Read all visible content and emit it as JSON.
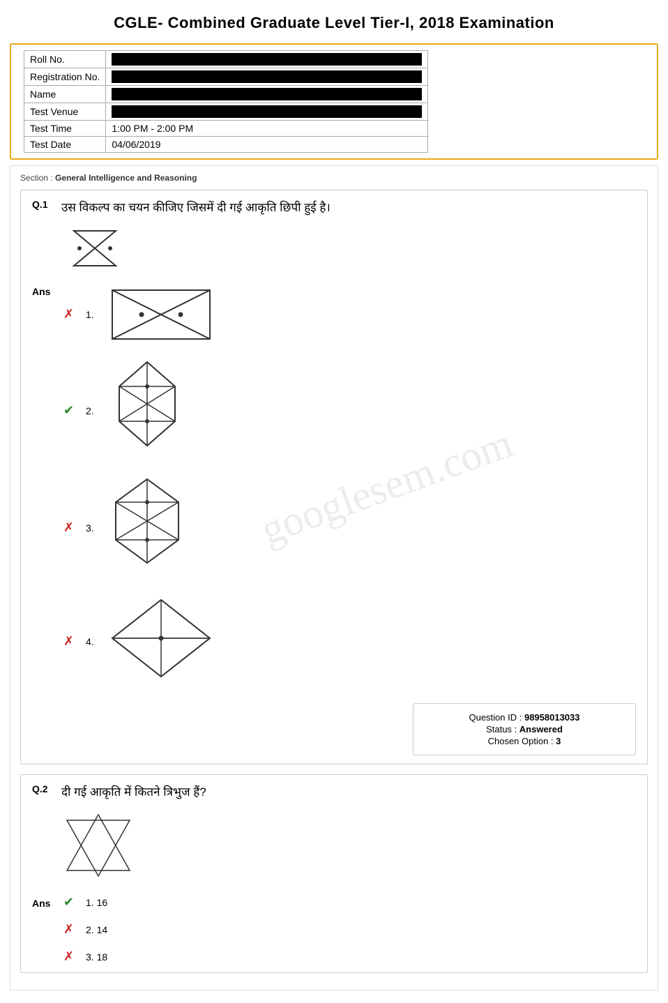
{
  "exam": {
    "title": "CGLE- Combined Graduate Level Tier-I, 2018 Examination",
    "fields": [
      {
        "label": "Roll No.",
        "redacted": true,
        "value": ""
      },
      {
        "label": "Registration No.",
        "redacted": true,
        "value": ""
      },
      {
        "label": "Name",
        "redacted": true,
        "value": ""
      },
      {
        "label": "Test Venue",
        "redacted": true,
        "value": ""
      },
      {
        "label": "Test Time",
        "redacted": false,
        "value": "1:00 PM - 2:00 PM"
      },
      {
        "label": "Test Date",
        "redacted": false,
        "value": "04/06/2019"
      }
    ]
  },
  "section": {
    "label": "Section :",
    "name": "General Intelligence and Reasoning"
  },
  "questions": [
    {
      "num": "Q.1",
      "text": "उस विकल्प का चयन कीजिए जिसमें दी गई आकृति छिपी हुई है।",
      "ans_label": "Ans",
      "options": [
        {
          "num": "1.",
          "correct": false
        },
        {
          "num": "2.",
          "correct": true
        },
        {
          "num": "3.",
          "correct": false
        },
        {
          "num": "4.",
          "correct": false
        }
      ],
      "question_id": "98958013033",
      "status": "Answered",
      "chosen_option": "3",
      "labels": {
        "question_id_label": "Question ID :",
        "status_label": "Status :",
        "chosen_option_label": "Chosen Option :"
      }
    },
    {
      "num": "Q.2",
      "text": "दी गई आकृति में कितने त्रिभुज हैं?",
      "ans_label": "Ans",
      "options": [
        {
          "num": "1. 16",
          "correct": true
        },
        {
          "num": "2. 14",
          "correct": false
        },
        {
          "num": "3. 18",
          "correct": false
        }
      ]
    }
  ],
  "watermark": "googlesem.com"
}
